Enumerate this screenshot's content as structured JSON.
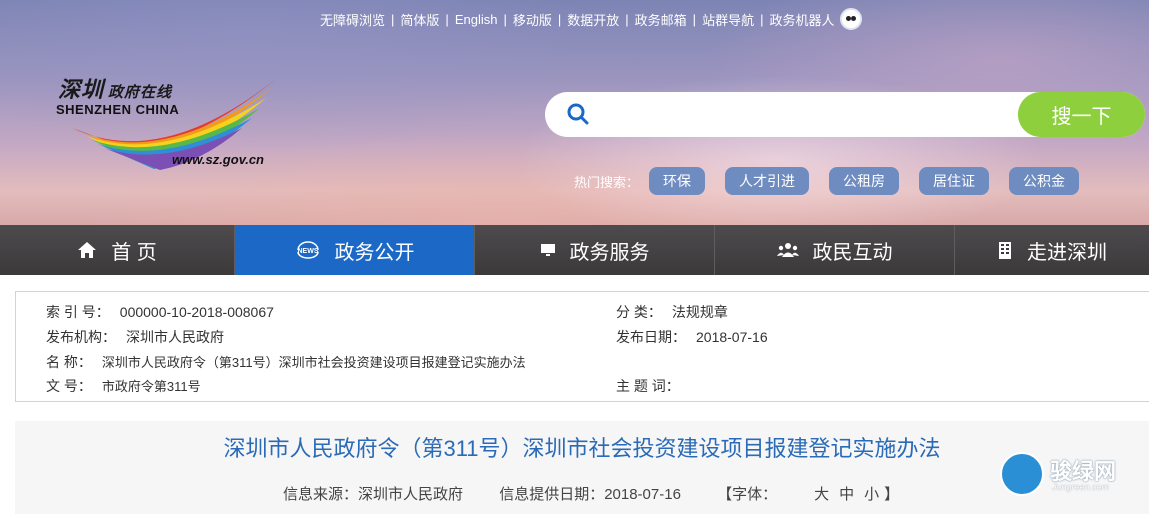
{
  "top_links": [
    "无障碍浏览",
    "简体版",
    "English",
    "移动版",
    "数据开放",
    "政务邮箱",
    "站群导航",
    "政务机器人"
  ],
  "logo": {
    "cn_name": "深圳",
    "cn_sub": "政府在线",
    "en_name": "SHENZHEN CHINA",
    "url": "www.sz.gov.cn"
  },
  "search": {
    "placeholder": "",
    "button_label": "搜一下",
    "hot_label": "热门搜索：",
    "hot_tags": [
      "环保",
      "人才引进",
      "公租房",
      "居住证",
      "公积金"
    ]
  },
  "nav": [
    {
      "label": "首 页",
      "icon": "home-icon"
    },
    {
      "label": "政务公开",
      "icon": "news-icon",
      "active": true
    },
    {
      "label": "政务服务",
      "icon": "monitor-icon"
    },
    {
      "label": "政民互动",
      "icon": "people-icon"
    },
    {
      "label": "走进深圳",
      "icon": "building-icon"
    }
  ],
  "meta": {
    "index_label": "索 引 号：",
    "index_value": "000000-10-2018-008067",
    "category_label": "分 类：",
    "category_value": "法规规章",
    "publisher_label": "发布机构：",
    "publisher_value": "深圳市人民政府",
    "date_label": "发布日期：",
    "date_value": "2018-07-16",
    "name_label": "名 称：",
    "name_value": "深圳市人民政府令（第311号）深圳市社会投资建设项目报建登记实施办法",
    "doc_label": "文 号：",
    "doc_value": "市政府令第311号",
    "keyword_label": "主 题 词：",
    "keyword_value": ""
  },
  "article": {
    "title": "深圳市人民政府令（第311号）深圳市社会投资建设项目报建登记实施办法",
    "source": "信息来源：深圳市人民政府",
    "provide_date": "信息提供日期：2018-07-16",
    "font_label_open": "【字体：",
    "font_large": "大",
    "font_medium": "中",
    "font_small": "小",
    "font_label_close": "】"
  },
  "watermark": {
    "text": "骏绿网",
    "sub": "Jungreen.com"
  },
  "colors": {
    "nav_active": "#1c68c6",
    "search_button": "#8ecf3e",
    "title": "#2a6ab7",
    "hot_tag": "#6f8cc0"
  }
}
